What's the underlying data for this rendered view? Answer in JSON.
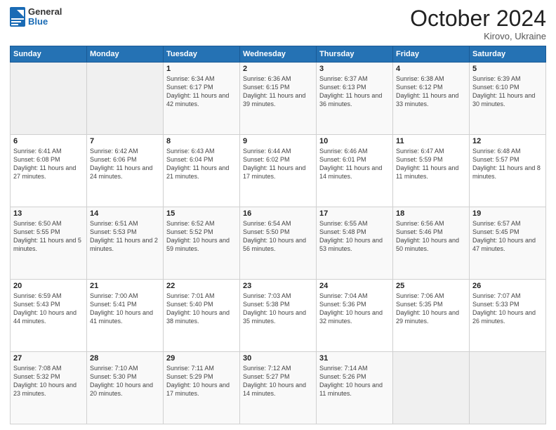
{
  "header": {
    "logo_general": "General",
    "logo_blue": "Blue",
    "month_title": "October 2024",
    "subtitle": "Kirovo, Ukraine"
  },
  "calendar": {
    "days_of_week": [
      "Sunday",
      "Monday",
      "Tuesday",
      "Wednesday",
      "Thursday",
      "Friday",
      "Saturday"
    ],
    "weeks": [
      [
        {
          "day": "",
          "info": ""
        },
        {
          "day": "",
          "info": ""
        },
        {
          "day": "1",
          "info": "Sunrise: 6:34 AM\nSunset: 6:17 PM\nDaylight: 11 hours and 42 minutes."
        },
        {
          "day": "2",
          "info": "Sunrise: 6:36 AM\nSunset: 6:15 PM\nDaylight: 11 hours and 39 minutes."
        },
        {
          "day": "3",
          "info": "Sunrise: 6:37 AM\nSunset: 6:13 PM\nDaylight: 11 hours and 36 minutes."
        },
        {
          "day": "4",
          "info": "Sunrise: 6:38 AM\nSunset: 6:12 PM\nDaylight: 11 hours and 33 minutes."
        },
        {
          "day": "5",
          "info": "Sunrise: 6:39 AM\nSunset: 6:10 PM\nDaylight: 11 hours and 30 minutes."
        }
      ],
      [
        {
          "day": "6",
          "info": "Sunrise: 6:41 AM\nSunset: 6:08 PM\nDaylight: 11 hours and 27 minutes."
        },
        {
          "day": "7",
          "info": "Sunrise: 6:42 AM\nSunset: 6:06 PM\nDaylight: 11 hours and 24 minutes."
        },
        {
          "day": "8",
          "info": "Sunrise: 6:43 AM\nSunset: 6:04 PM\nDaylight: 11 hours and 21 minutes."
        },
        {
          "day": "9",
          "info": "Sunrise: 6:44 AM\nSunset: 6:02 PM\nDaylight: 11 hours and 17 minutes."
        },
        {
          "day": "10",
          "info": "Sunrise: 6:46 AM\nSunset: 6:01 PM\nDaylight: 11 hours and 14 minutes."
        },
        {
          "day": "11",
          "info": "Sunrise: 6:47 AM\nSunset: 5:59 PM\nDaylight: 11 hours and 11 minutes."
        },
        {
          "day": "12",
          "info": "Sunrise: 6:48 AM\nSunset: 5:57 PM\nDaylight: 11 hours and 8 minutes."
        }
      ],
      [
        {
          "day": "13",
          "info": "Sunrise: 6:50 AM\nSunset: 5:55 PM\nDaylight: 11 hours and 5 minutes."
        },
        {
          "day": "14",
          "info": "Sunrise: 6:51 AM\nSunset: 5:53 PM\nDaylight: 11 hours and 2 minutes."
        },
        {
          "day": "15",
          "info": "Sunrise: 6:52 AM\nSunset: 5:52 PM\nDaylight: 10 hours and 59 minutes."
        },
        {
          "day": "16",
          "info": "Sunrise: 6:54 AM\nSunset: 5:50 PM\nDaylight: 10 hours and 56 minutes."
        },
        {
          "day": "17",
          "info": "Sunrise: 6:55 AM\nSunset: 5:48 PM\nDaylight: 10 hours and 53 minutes."
        },
        {
          "day": "18",
          "info": "Sunrise: 6:56 AM\nSunset: 5:46 PM\nDaylight: 10 hours and 50 minutes."
        },
        {
          "day": "19",
          "info": "Sunrise: 6:57 AM\nSunset: 5:45 PM\nDaylight: 10 hours and 47 minutes."
        }
      ],
      [
        {
          "day": "20",
          "info": "Sunrise: 6:59 AM\nSunset: 5:43 PM\nDaylight: 10 hours and 44 minutes."
        },
        {
          "day": "21",
          "info": "Sunrise: 7:00 AM\nSunset: 5:41 PM\nDaylight: 10 hours and 41 minutes."
        },
        {
          "day": "22",
          "info": "Sunrise: 7:01 AM\nSunset: 5:40 PM\nDaylight: 10 hours and 38 minutes."
        },
        {
          "day": "23",
          "info": "Sunrise: 7:03 AM\nSunset: 5:38 PM\nDaylight: 10 hours and 35 minutes."
        },
        {
          "day": "24",
          "info": "Sunrise: 7:04 AM\nSunset: 5:36 PM\nDaylight: 10 hours and 32 minutes."
        },
        {
          "day": "25",
          "info": "Sunrise: 7:06 AM\nSunset: 5:35 PM\nDaylight: 10 hours and 29 minutes."
        },
        {
          "day": "26",
          "info": "Sunrise: 7:07 AM\nSunset: 5:33 PM\nDaylight: 10 hours and 26 minutes."
        }
      ],
      [
        {
          "day": "27",
          "info": "Sunrise: 7:08 AM\nSunset: 5:32 PM\nDaylight: 10 hours and 23 minutes."
        },
        {
          "day": "28",
          "info": "Sunrise: 7:10 AM\nSunset: 5:30 PM\nDaylight: 10 hours and 20 minutes."
        },
        {
          "day": "29",
          "info": "Sunrise: 7:11 AM\nSunset: 5:29 PM\nDaylight: 10 hours and 17 minutes."
        },
        {
          "day": "30",
          "info": "Sunrise: 7:12 AM\nSunset: 5:27 PM\nDaylight: 10 hours and 14 minutes."
        },
        {
          "day": "31",
          "info": "Sunrise: 7:14 AM\nSunset: 5:26 PM\nDaylight: 10 hours and 11 minutes."
        },
        {
          "day": "",
          "info": ""
        },
        {
          "day": "",
          "info": ""
        }
      ]
    ]
  }
}
